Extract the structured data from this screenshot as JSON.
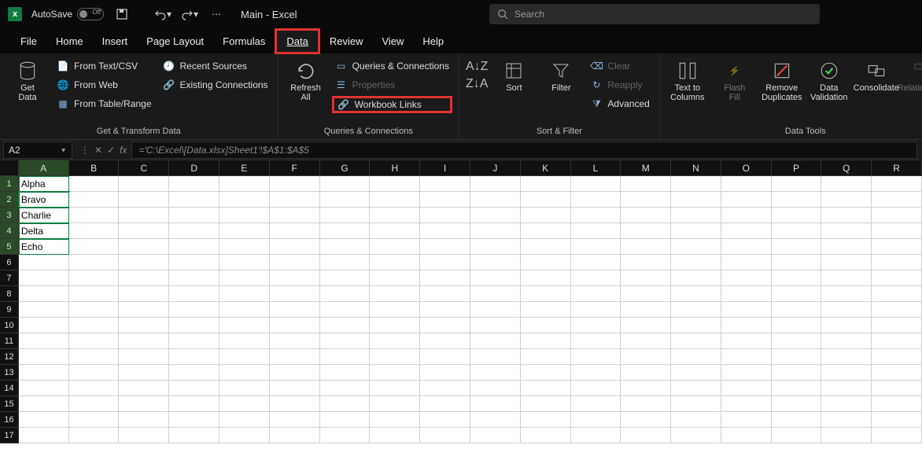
{
  "titlebar": {
    "autosave_label": "AutoSave",
    "autosave_state": "Off",
    "doc_title": "Main - Excel",
    "search_placeholder": "Search"
  },
  "tabs": {
    "file": "File",
    "home": "Home",
    "insert": "Insert",
    "page_layout": "Page Layout",
    "formulas": "Formulas",
    "data": "Data",
    "review": "Review",
    "view": "View",
    "help": "Help"
  },
  "ribbon": {
    "get_transform": {
      "get_data": "Get\nData",
      "from_text_csv": "From Text/CSV",
      "from_web": "From Web",
      "from_table_range": "From Table/Range",
      "recent_sources": "Recent Sources",
      "existing_connections": "Existing Connections",
      "label": "Get & Transform Data"
    },
    "queries": {
      "refresh_all": "Refresh\nAll",
      "queries_connections": "Queries & Connections",
      "properties": "Properties",
      "workbook_links": "Workbook Links",
      "label": "Queries & Connections"
    },
    "sort_filter": {
      "sort": "Sort",
      "filter": "Filter",
      "clear": "Clear",
      "reapply": "Reapply",
      "advanced": "Advanced",
      "label": "Sort & Filter"
    },
    "data_tools": {
      "text_to_columns": "Text to\nColumns",
      "flash_fill": "Flash\nFill",
      "remove_duplicates": "Remove\nDuplicates",
      "data_validation": "Data\nValidation",
      "consolidate": "Consolidate",
      "relationships": "Relationships",
      "label": "Data Tools"
    }
  },
  "formula_bar": {
    "namebox": "A2",
    "formula": "='C:\\Excel\\[Data.xlsx]Sheet1'!$A$1:$A$5"
  },
  "grid": {
    "columns": [
      "A",
      "B",
      "C",
      "D",
      "E",
      "F",
      "G",
      "H",
      "I",
      "J",
      "K",
      "L",
      "M",
      "N",
      "O",
      "P",
      "Q",
      "R"
    ],
    "rows": [
      1,
      2,
      3,
      4,
      5,
      6,
      7,
      8,
      9,
      10,
      11,
      12,
      13,
      14,
      15,
      16,
      17
    ],
    "data": {
      "A1": "Alpha",
      "A2": "Bravo",
      "A3": "Charlie",
      "A4": "Delta",
      "A5": "Echo"
    },
    "active_cell": "A2",
    "selected_range": [
      "A1",
      "A5"
    ]
  }
}
